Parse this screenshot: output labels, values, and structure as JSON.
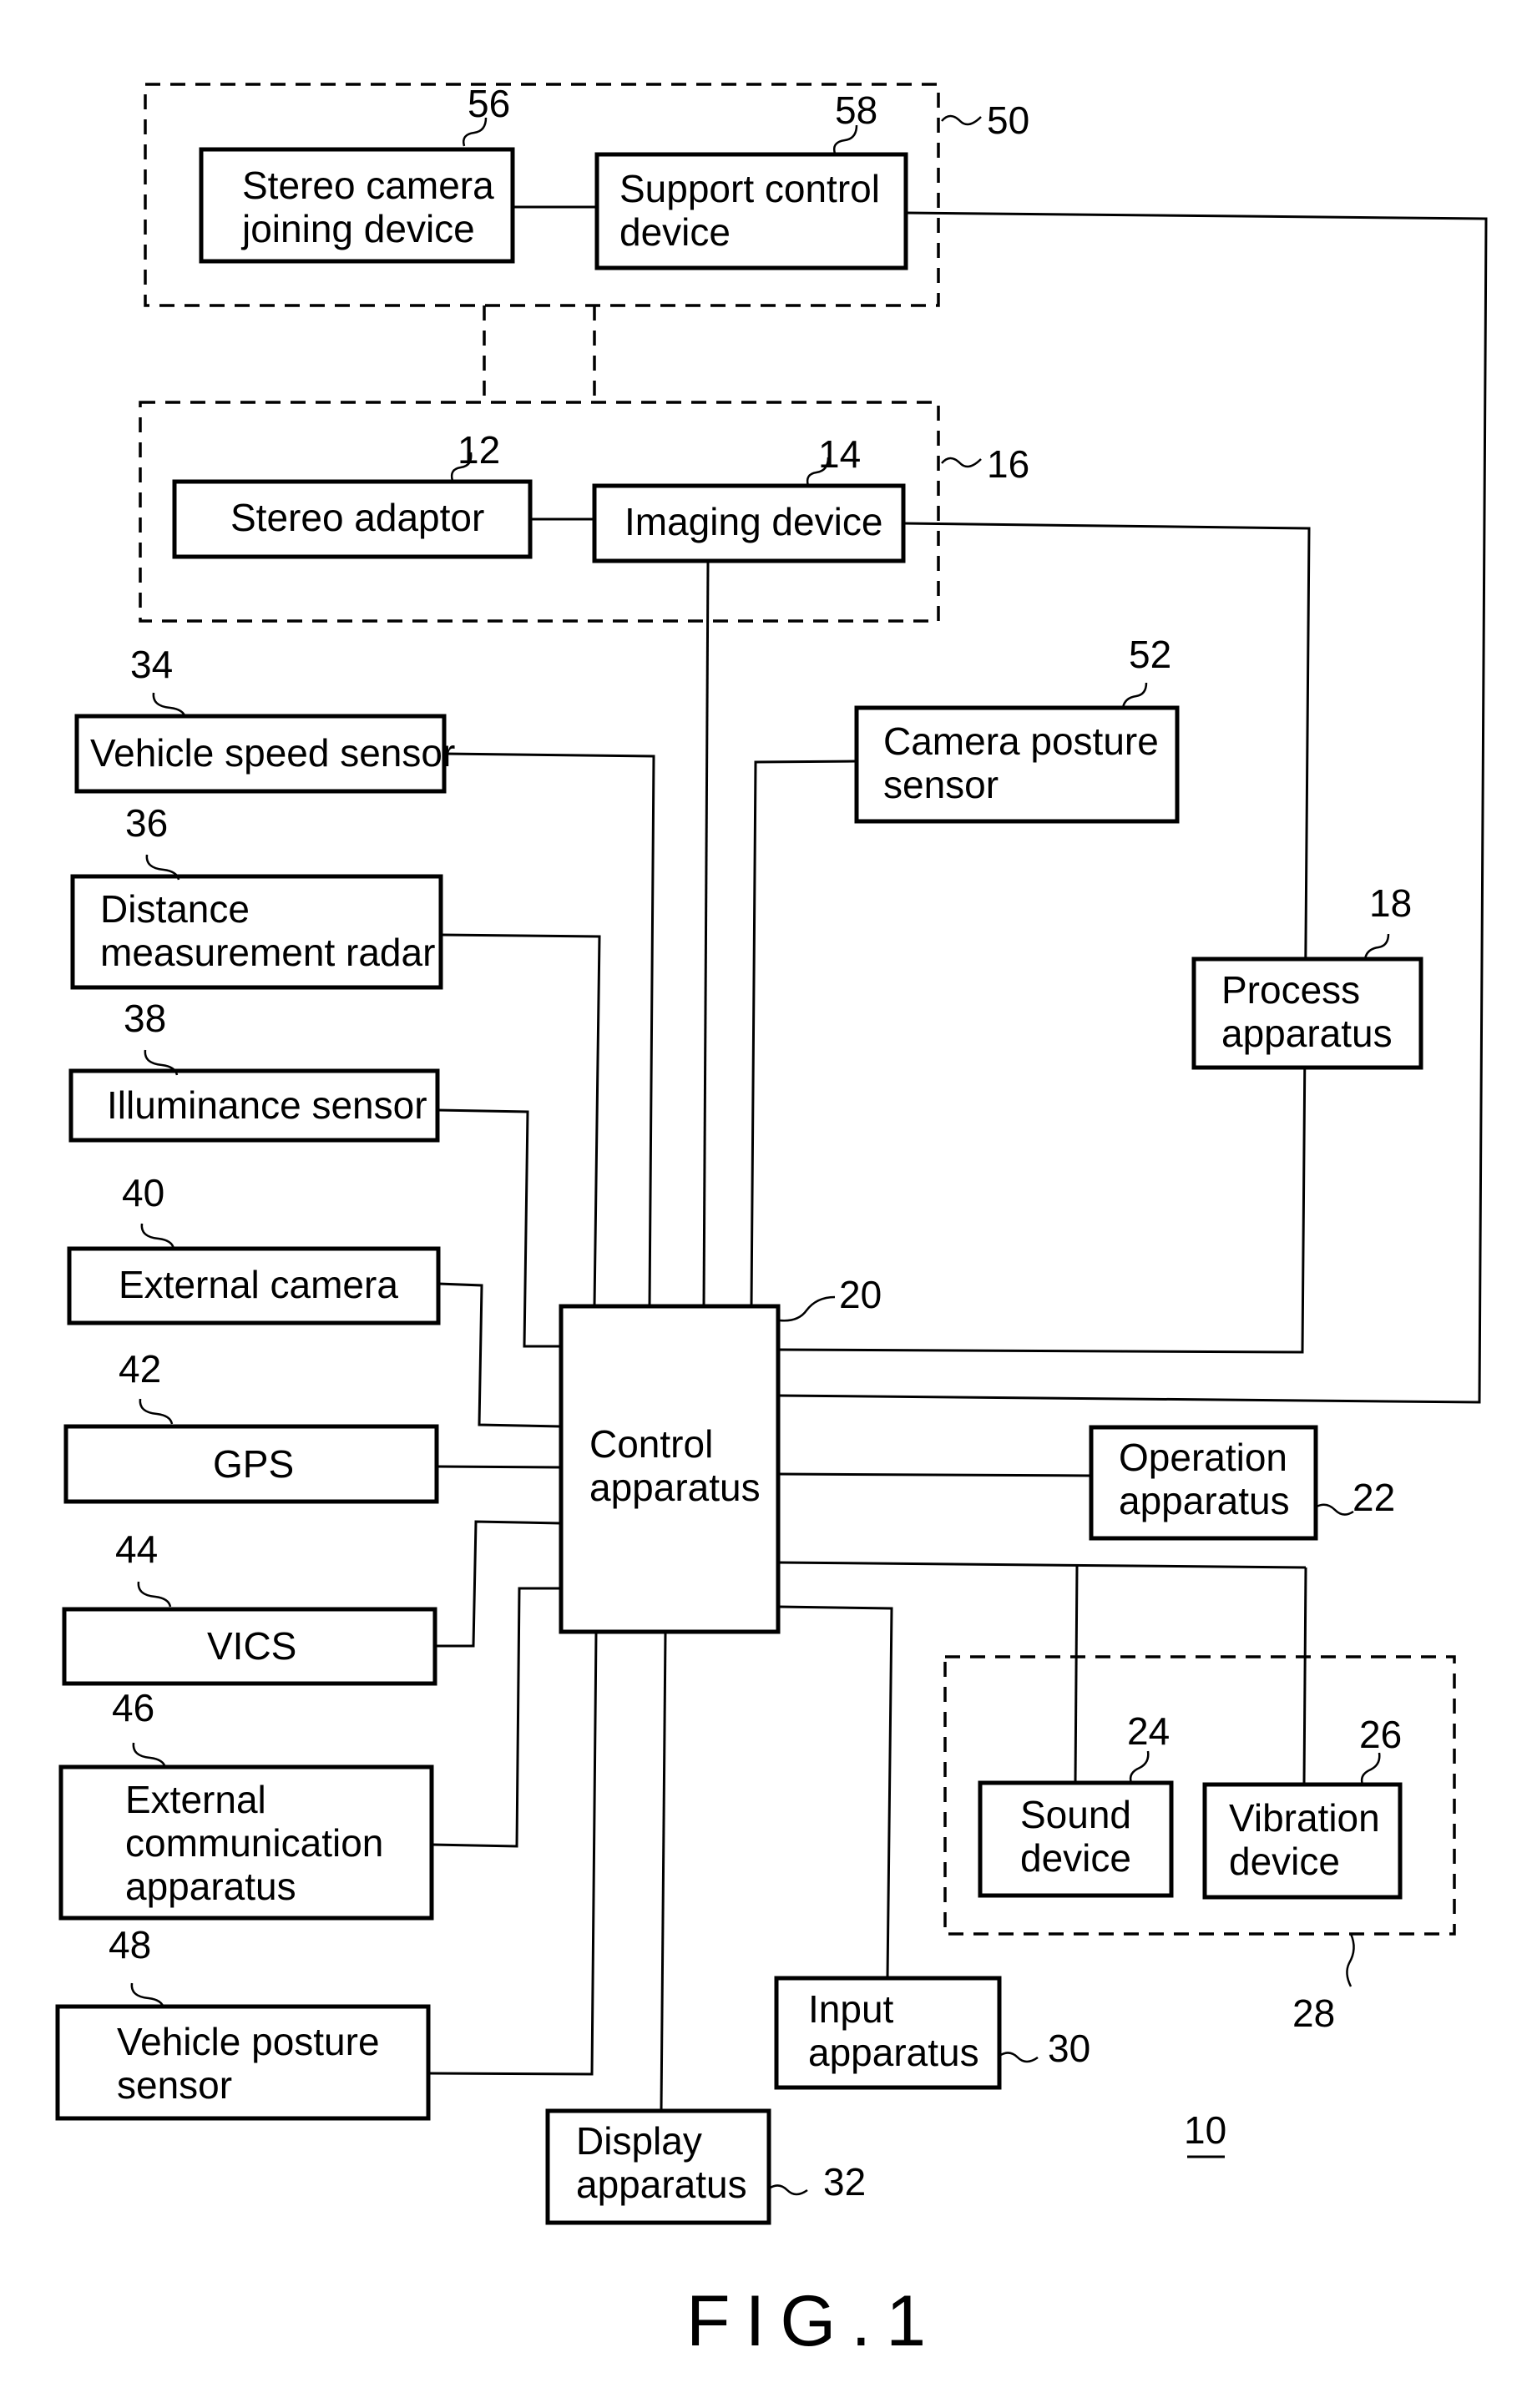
{
  "figure": {
    "caption": "FIG.1",
    "system_ref": "10"
  },
  "groups": {
    "camera_support": {
      "ref": "50"
    },
    "camera_unit": {
      "ref": "16"
    },
    "alert_unit": {
      "ref": "28"
    }
  },
  "blocks": {
    "stereo_camera_joining": {
      "ref": "56",
      "lines": [
        "Stereo camera",
        "joining device"
      ]
    },
    "support_control": {
      "ref": "58",
      "lines": [
        "Support control",
        "device"
      ]
    },
    "stereo_adaptor": {
      "ref": "12",
      "lines": [
        "Stereo adaptor"
      ]
    },
    "imaging_device": {
      "ref": "14",
      "lines": [
        "Imaging device"
      ]
    },
    "vehicle_speed_sensor": {
      "ref": "34",
      "lines": [
        "Vehicle speed sensor"
      ]
    },
    "distance_radar": {
      "ref": "36",
      "lines": [
        "Distance",
        "measurement radar"
      ]
    },
    "illuminance_sensor": {
      "ref": "38",
      "lines": [
        "Illuminance sensor"
      ]
    },
    "external_camera": {
      "ref": "40",
      "lines": [
        "External camera"
      ]
    },
    "gps": {
      "ref": "42",
      "lines": [
        "GPS"
      ]
    },
    "vics": {
      "ref": "44",
      "lines": [
        "VICS"
      ]
    },
    "external_communication": {
      "ref": "46",
      "lines": [
        "External",
        "communication",
        "apparatus"
      ]
    },
    "vehicle_posture_sensor": {
      "ref": "48",
      "lines": [
        "Vehicle posture",
        "sensor"
      ]
    },
    "camera_posture_sensor": {
      "ref": "52",
      "lines": [
        "Camera posture",
        "sensor"
      ]
    },
    "process_apparatus": {
      "ref": "18",
      "lines": [
        "Process",
        "apparatus"
      ]
    },
    "control_apparatus": {
      "ref": "20",
      "lines": [
        "Control",
        "apparatus"
      ]
    },
    "operation_apparatus": {
      "ref": "22",
      "lines": [
        "Operation",
        "apparatus"
      ]
    },
    "sound_device": {
      "ref": "24",
      "lines": [
        "Sound",
        "device"
      ]
    },
    "vibration_device": {
      "ref": "26",
      "lines": [
        "Vibration",
        "device"
      ]
    },
    "input_apparatus": {
      "ref": "30",
      "lines": [
        "Input",
        "apparatus"
      ]
    },
    "display_apparatus": {
      "ref": "32",
      "lines": [
        "Display",
        "apparatus"
      ]
    }
  }
}
